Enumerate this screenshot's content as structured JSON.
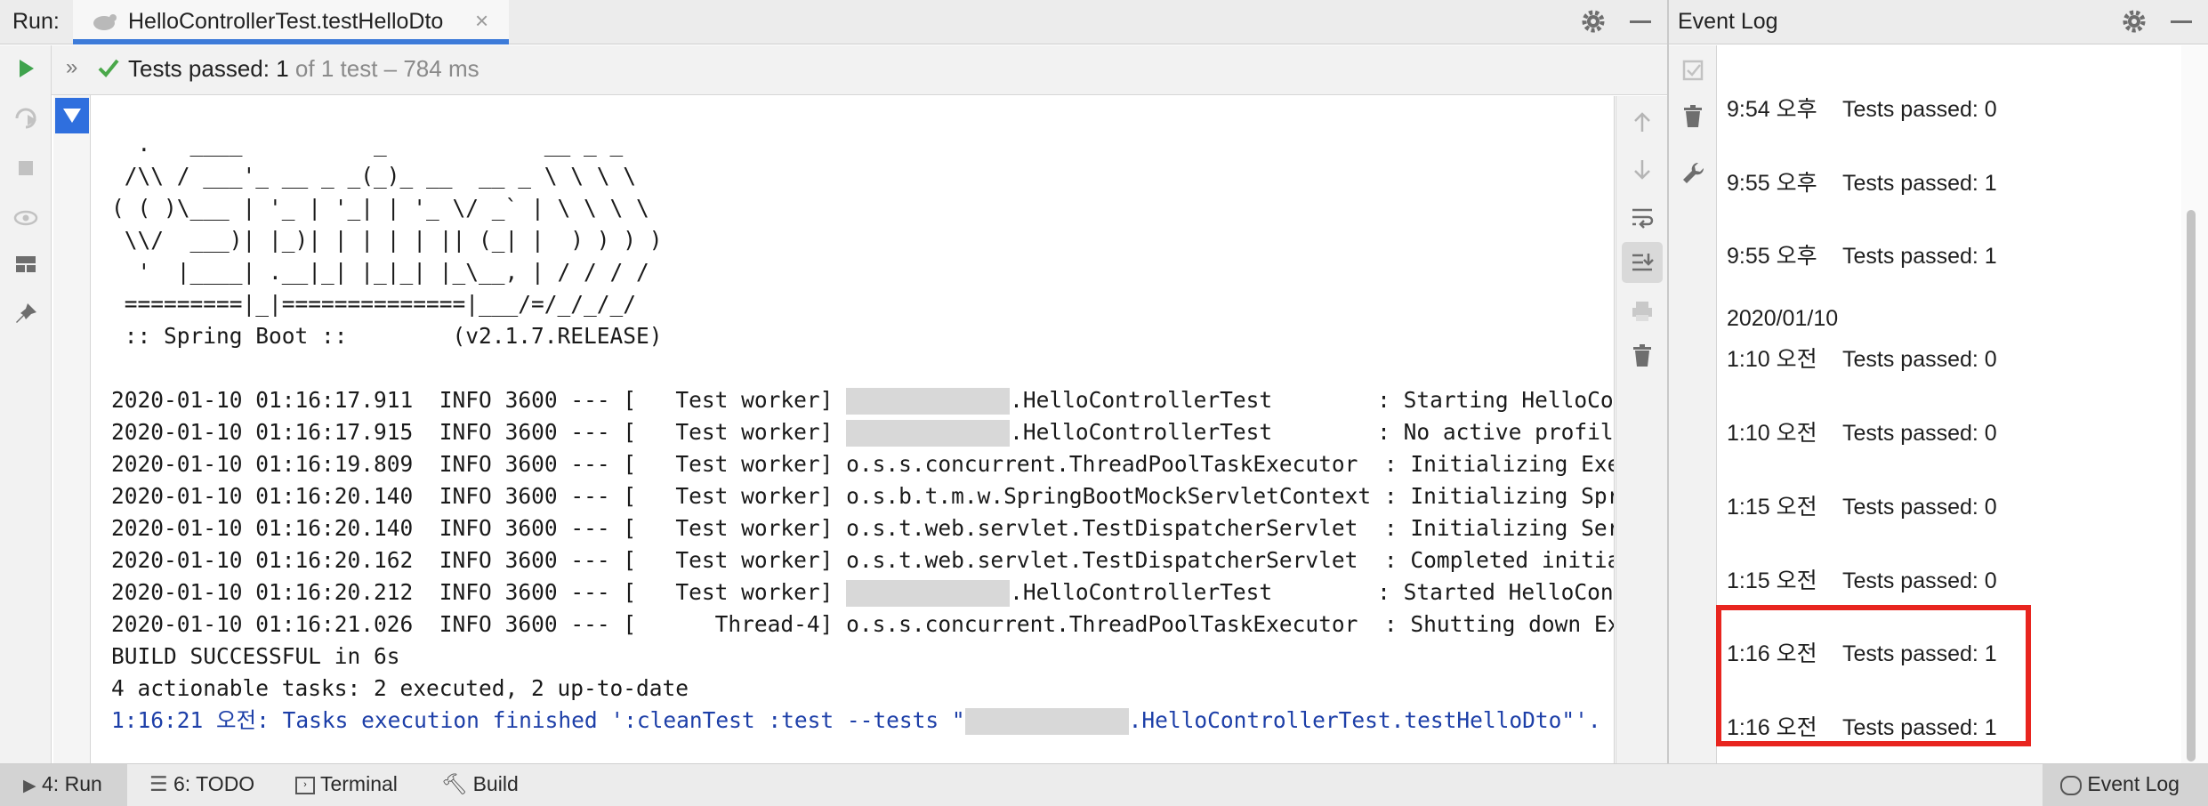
{
  "run_panel": {
    "label": "Run:",
    "tab_title": "HelloControllerTest.testHelloDto",
    "summary": {
      "status": "Tests passed:",
      "passed": "1",
      "of_total": "of 1 test",
      "duration": "– 784 ms"
    },
    "console_lines": [
      "  .   ____          _            __ _ _",
      " /\\\\ / ___'_ __ _ _(_)_ __  __ _ \\ \\ \\ \\",
      "( ( )\\___ | '_ | '_| | '_ \\/ _` | \\ \\ \\ \\",
      " \\\\/  ___)| |_)| | | | | || (_| |  ) ) ) )",
      "  '  |____| .__|_| |_|_| |_\\__, | / / / /",
      " =========|_|==============|___/=/_/_/_/",
      " :: Spring Boot ::        (v2.1.7.RELEASE)",
      ""
    ],
    "log_lines": [
      {
        "ts": "2020-01-10 01:16:17.911",
        "level": "INFO",
        "pid": "3600",
        "thread": "   Test worker",
        "masked": true,
        "logger": ".HelloControllerTest       ",
        "msg": " : Starting HelloControl"
      },
      {
        "ts": "2020-01-10 01:16:17.915",
        "level": "INFO",
        "pid": "3600",
        "thread": "   Test worker",
        "masked": true,
        "logger": ".HelloControllerTest       ",
        "msg": " : No active profile set"
      },
      {
        "ts": "2020-01-10 01:16:19.809",
        "level": "INFO",
        "pid": "3600",
        "thread": "   Test worker",
        "masked": false,
        "logger": "o.s.s.concurrent.ThreadPoolTaskExecutor ",
        "msg": " : Initializing Executor"
      },
      {
        "ts": "2020-01-10 01:16:20.140",
        "level": "INFO",
        "pid": "3600",
        "thread": "   Test worker",
        "masked": false,
        "logger": "o.s.b.t.m.w.SpringBootMockServletContext",
        "msg": " : Initializing Spring T"
      },
      {
        "ts": "2020-01-10 01:16:20.140",
        "level": "INFO",
        "pid": "3600",
        "thread": "   Test worker",
        "masked": false,
        "logger": "o.s.t.web.servlet.TestDispatcherServlet ",
        "msg": " : Initializing Servlet"
      },
      {
        "ts": "2020-01-10 01:16:20.162",
        "level": "INFO",
        "pid": "3600",
        "thread": "   Test worker",
        "masked": false,
        "logger": "o.s.t.web.servlet.TestDispatcherServlet ",
        "msg": " : Completed initializat"
      },
      {
        "ts": "2020-01-10 01:16:20.212",
        "level": "INFO",
        "pid": "3600",
        "thread": "   Test worker",
        "masked": true,
        "logger": ".HelloControllerTest       ",
        "msg": " : Started HelloControll"
      },
      {
        "ts": "2020-01-10 01:16:21.026",
        "level": "INFO",
        "pid": "3600",
        "thread": "      Thread-4",
        "masked": false,
        "logger": "o.s.s.concurrent.ThreadPoolTaskExecutor ",
        "msg": " : Shutting down Executo"
      }
    ],
    "build_result": "BUILD SUCCESSFUL in 6s",
    "actionable": "4 actionable tasks: 2 executed, 2 up-to-date",
    "finished_prefix": "1:16:21 오전: Tasks execution finished ':cleanTest :test --tests \"",
    "finished_suffix": ".HelloControllerTest.testHelloDto\"'."
  },
  "event_log": {
    "title": "Event Log",
    "top_clipped": "...",
    "entries_before_date": [
      {
        "time": "9:54 오후",
        "text": "Tests passed: 0"
      },
      {
        "time": "9:55 오후",
        "text": "Tests passed: 1"
      },
      {
        "time": "9:55 오후",
        "text": "Tests passed: 1"
      }
    ],
    "date": "2020/01/10",
    "entries_after_date": [
      {
        "time": "1:10 오전",
        "text": "Tests passed: 0"
      },
      {
        "time": "1:10 오전",
        "text": "Tests passed: 0"
      },
      {
        "time": "1:15 오전",
        "text": "Tests passed: 0"
      },
      {
        "time": "1:15 오전",
        "text": "Tests passed: 0"
      },
      {
        "time": "1:16 오전",
        "text": "Tests passed: 1"
      },
      {
        "time": "1:16 오전",
        "text": "Tests passed: 1"
      }
    ]
  },
  "bottom_bar": {
    "run_tab": "4: Run",
    "todo_tab": "6: TODO",
    "terminal_tab": "Terminal",
    "build_tab": "Build",
    "event_log_tab": "Event Log"
  },
  "colors": {
    "accent": "#3d7bd9",
    "pass_green": "#4aa84a",
    "highlight_red": "#e8251f",
    "link_blue": "#1d3fa8"
  }
}
